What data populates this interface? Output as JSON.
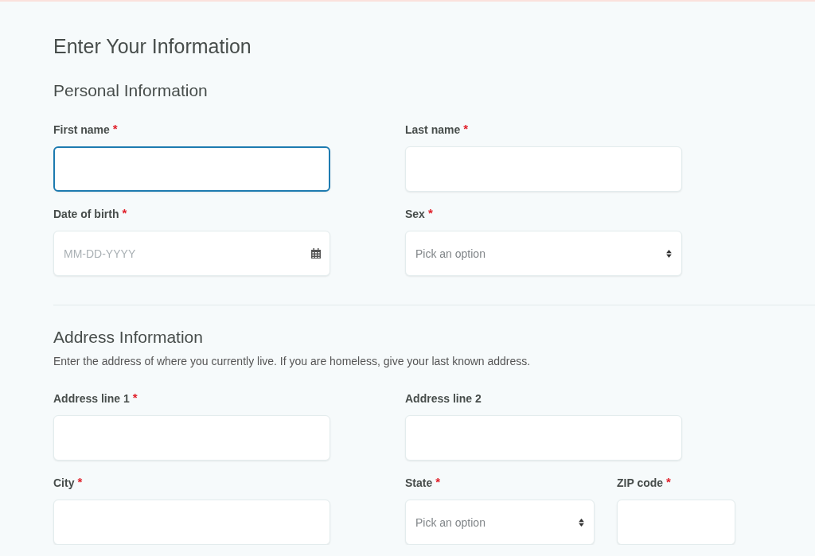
{
  "title": "Enter Your Information",
  "sections": [
    {
      "heading": "Personal Information",
      "rows": [
        [
          {
            "label": "First name",
            "required_mark": "*",
            "kind": "text",
            "focused": true
          },
          {
            "label": "Last name",
            "required_mark": "*",
            "kind": "text",
            "focused": false
          }
        ],
        [
          {
            "label": "Date of birth",
            "required_mark": "*",
            "kind": "date",
            "placeholder": "MM-DD-YYYY",
            "focused": false
          },
          {
            "label": "Sex",
            "required_mark": "*",
            "kind": "select",
            "placeholder": "Pick an option",
            "focused": false
          }
        ]
      ]
    },
    {
      "heading": "Address Information",
      "description": "Enter the address of where you currently live. If you are homeless, give your last known address.",
      "rows": [
        [
          {
            "label": "Address line 1",
            "required_mark": "*",
            "kind": "text",
            "focused": false
          },
          {
            "label": "Address line 2",
            "kind": "text",
            "focused": false
          }
        ],
        [
          {
            "label": "City",
            "required_mark": "*",
            "kind": "text",
            "focused": false
          },
          {
            "label": "State",
            "required_mark": "*",
            "kind": "select",
            "placeholder": "Pick an option",
            "focused": false
          },
          {
            "label": "ZIP code",
            "required_mark": "*",
            "kind": "text",
            "focused": false
          }
        ]
      ]
    }
  ]
}
